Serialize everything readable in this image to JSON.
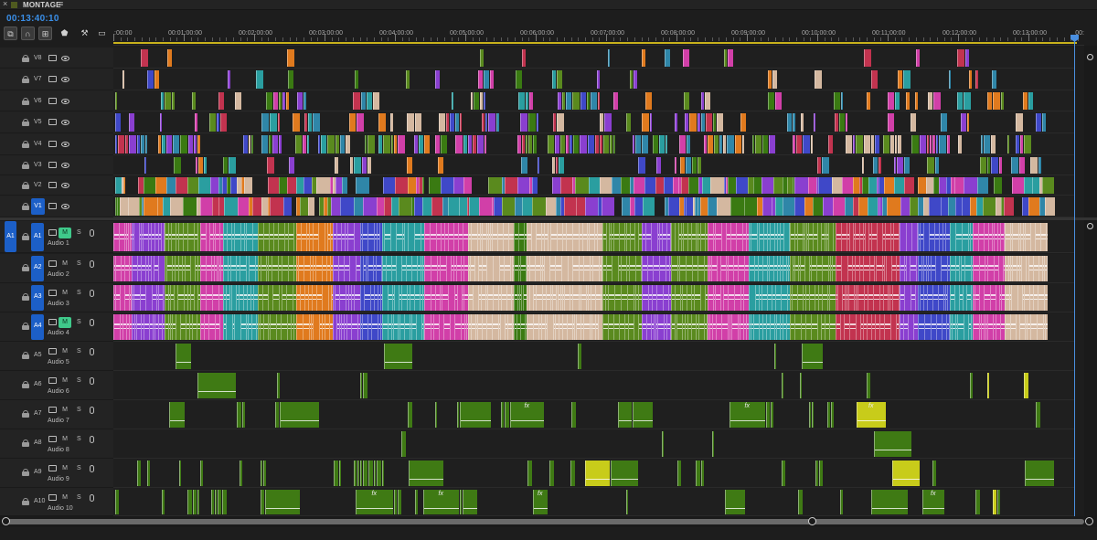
{
  "panel": {
    "close_glyph": "×",
    "title": "MONTAGE",
    "menu_glyph": "≡",
    "timecode": "00:13:40:10"
  },
  "toolbar": {
    "tools": [
      {
        "name": "insert-nest-icon",
        "glyph": "⧉",
        "active": true
      },
      {
        "name": "snap-icon",
        "glyph": "∩",
        "active": true
      },
      {
        "name": "linked-selection-icon",
        "glyph": "⊞",
        "active": true
      },
      {
        "name": "add-marker-icon",
        "glyph": "⬟",
        "active": false
      },
      {
        "name": "wrench-icon",
        "glyph": "⚒",
        "active": false
      },
      {
        "name": "captions-icon",
        "glyph": "▭",
        "active": false
      }
    ]
  },
  "ruler": {
    "labels": [
      ":00:00",
      "00:01:00:00",
      "00:02:00:00",
      "00:03:00:00",
      "00:04:00:00",
      "00:05:00:00",
      "00:06:00:00",
      "00:07:00:00",
      "00:08:00:00",
      "00:09:00:00",
      "00:10:00:00",
      "00:11:00:00",
      "00:12:00:00",
      "00:13:00:00"
    ],
    "end_label": "00:"
  },
  "video_tracks": [
    {
      "name": "V8"
    },
    {
      "name": "V7"
    },
    {
      "name": "V6"
    },
    {
      "name": "V5"
    },
    {
      "name": "V4"
    },
    {
      "name": "V3"
    },
    {
      "name": "V2"
    },
    {
      "name": "V1",
      "targeted": true
    }
  ],
  "audio_tracks": [
    {
      "name": "A1",
      "label": "Audio 1",
      "source": "A1",
      "targeted": true,
      "muted": true
    },
    {
      "name": "A2",
      "label": "Audio 2",
      "source": "",
      "targeted": true,
      "muted": false
    },
    {
      "name": "A3",
      "label": "Audio 3",
      "source": "",
      "targeted": true,
      "muted": false
    },
    {
      "name": "A4",
      "label": "Audio 4",
      "source": "",
      "targeted": true,
      "muted": true
    },
    {
      "name": "A5",
      "label": "Audio 5",
      "source": "",
      "targeted": false,
      "muted": false
    },
    {
      "name": "A6",
      "label": "Audio 6",
      "source": "",
      "targeted": false,
      "muted": false
    },
    {
      "name": "A7",
      "label": "Audio 7",
      "source": "",
      "targeted": false,
      "muted": false
    },
    {
      "name": "A8",
      "label": "Audio 8",
      "source": "",
      "targeted": false,
      "muted": false
    },
    {
      "name": "A9",
      "label": "Audio 9",
      "source": "",
      "targeted": false,
      "muted": false
    },
    {
      "name": "A10",
      "label": "Audio 10",
      "source": "",
      "targeted": false,
      "muted": false
    }
  ],
  "controls": {
    "mute_label": "M",
    "solo_label": "S",
    "fx_label": "fx"
  },
  "colors": {
    "accent": "#3a8fe8",
    "target_blue": "#1c5fc7",
    "mute_green": "#3fc98a",
    "work_area": "#c8b21c",
    "clip_palette": [
      "#2f86a8",
      "#8a3fd0",
      "#e07a1e",
      "#5a8a1e",
      "#d13fa8",
      "#c2334f",
      "#2a9ea0",
      "#d4b8a0",
      "#3f48c8",
      "#3a7a12"
    ]
  }
}
